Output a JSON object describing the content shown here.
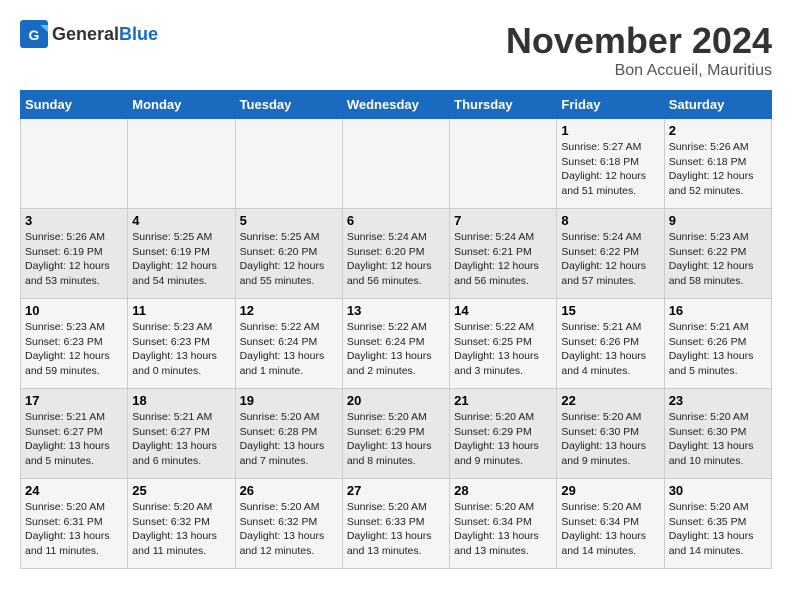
{
  "header": {
    "logo_general": "General",
    "logo_blue": "Blue",
    "month_title": "November 2024",
    "location": "Bon Accueil, Mauritius"
  },
  "weekdays": [
    "Sunday",
    "Monday",
    "Tuesday",
    "Wednesday",
    "Thursday",
    "Friday",
    "Saturday"
  ],
  "weeks": [
    [
      {
        "day": "",
        "info": ""
      },
      {
        "day": "",
        "info": ""
      },
      {
        "day": "",
        "info": ""
      },
      {
        "day": "",
        "info": ""
      },
      {
        "day": "",
        "info": ""
      },
      {
        "day": "1",
        "info": "Sunrise: 5:27 AM\nSunset: 6:18 PM\nDaylight: 12 hours\nand 51 minutes."
      },
      {
        "day": "2",
        "info": "Sunrise: 5:26 AM\nSunset: 6:18 PM\nDaylight: 12 hours\nand 52 minutes."
      }
    ],
    [
      {
        "day": "3",
        "info": "Sunrise: 5:26 AM\nSunset: 6:19 PM\nDaylight: 12 hours\nand 53 minutes."
      },
      {
        "day": "4",
        "info": "Sunrise: 5:25 AM\nSunset: 6:19 PM\nDaylight: 12 hours\nand 54 minutes."
      },
      {
        "day": "5",
        "info": "Sunrise: 5:25 AM\nSunset: 6:20 PM\nDaylight: 12 hours\nand 55 minutes."
      },
      {
        "day": "6",
        "info": "Sunrise: 5:24 AM\nSunset: 6:20 PM\nDaylight: 12 hours\nand 56 minutes."
      },
      {
        "day": "7",
        "info": "Sunrise: 5:24 AM\nSunset: 6:21 PM\nDaylight: 12 hours\nand 56 minutes."
      },
      {
        "day": "8",
        "info": "Sunrise: 5:24 AM\nSunset: 6:22 PM\nDaylight: 12 hours\nand 57 minutes."
      },
      {
        "day": "9",
        "info": "Sunrise: 5:23 AM\nSunset: 6:22 PM\nDaylight: 12 hours\nand 58 minutes."
      }
    ],
    [
      {
        "day": "10",
        "info": "Sunrise: 5:23 AM\nSunset: 6:23 PM\nDaylight: 12 hours\nand 59 minutes."
      },
      {
        "day": "11",
        "info": "Sunrise: 5:23 AM\nSunset: 6:23 PM\nDaylight: 13 hours\nand 0 minutes."
      },
      {
        "day": "12",
        "info": "Sunrise: 5:22 AM\nSunset: 6:24 PM\nDaylight: 13 hours\nand 1 minute."
      },
      {
        "day": "13",
        "info": "Sunrise: 5:22 AM\nSunset: 6:24 PM\nDaylight: 13 hours\nand 2 minutes."
      },
      {
        "day": "14",
        "info": "Sunrise: 5:22 AM\nSunset: 6:25 PM\nDaylight: 13 hours\nand 3 minutes."
      },
      {
        "day": "15",
        "info": "Sunrise: 5:21 AM\nSunset: 6:26 PM\nDaylight: 13 hours\nand 4 minutes."
      },
      {
        "day": "16",
        "info": "Sunrise: 5:21 AM\nSunset: 6:26 PM\nDaylight: 13 hours\nand 5 minutes."
      }
    ],
    [
      {
        "day": "17",
        "info": "Sunrise: 5:21 AM\nSunset: 6:27 PM\nDaylight: 13 hours\nand 5 minutes."
      },
      {
        "day": "18",
        "info": "Sunrise: 5:21 AM\nSunset: 6:27 PM\nDaylight: 13 hours\nand 6 minutes."
      },
      {
        "day": "19",
        "info": "Sunrise: 5:20 AM\nSunset: 6:28 PM\nDaylight: 13 hours\nand 7 minutes."
      },
      {
        "day": "20",
        "info": "Sunrise: 5:20 AM\nSunset: 6:29 PM\nDaylight: 13 hours\nand 8 minutes."
      },
      {
        "day": "21",
        "info": "Sunrise: 5:20 AM\nSunset: 6:29 PM\nDaylight: 13 hours\nand 9 minutes."
      },
      {
        "day": "22",
        "info": "Sunrise: 5:20 AM\nSunset: 6:30 PM\nDaylight: 13 hours\nand 9 minutes."
      },
      {
        "day": "23",
        "info": "Sunrise: 5:20 AM\nSunset: 6:30 PM\nDaylight: 13 hours\nand 10 minutes."
      }
    ],
    [
      {
        "day": "24",
        "info": "Sunrise: 5:20 AM\nSunset: 6:31 PM\nDaylight: 13 hours\nand 11 minutes."
      },
      {
        "day": "25",
        "info": "Sunrise: 5:20 AM\nSunset: 6:32 PM\nDaylight: 13 hours\nand 11 minutes."
      },
      {
        "day": "26",
        "info": "Sunrise: 5:20 AM\nSunset: 6:32 PM\nDaylight: 13 hours\nand 12 minutes."
      },
      {
        "day": "27",
        "info": "Sunrise: 5:20 AM\nSunset: 6:33 PM\nDaylight: 13 hours\nand 13 minutes."
      },
      {
        "day": "28",
        "info": "Sunrise: 5:20 AM\nSunset: 6:34 PM\nDaylight: 13 hours\nand 13 minutes."
      },
      {
        "day": "29",
        "info": "Sunrise: 5:20 AM\nSunset: 6:34 PM\nDaylight: 13 hours\nand 14 minutes."
      },
      {
        "day": "30",
        "info": "Sunrise: 5:20 AM\nSunset: 6:35 PM\nDaylight: 13 hours\nand 14 minutes."
      }
    ]
  ]
}
